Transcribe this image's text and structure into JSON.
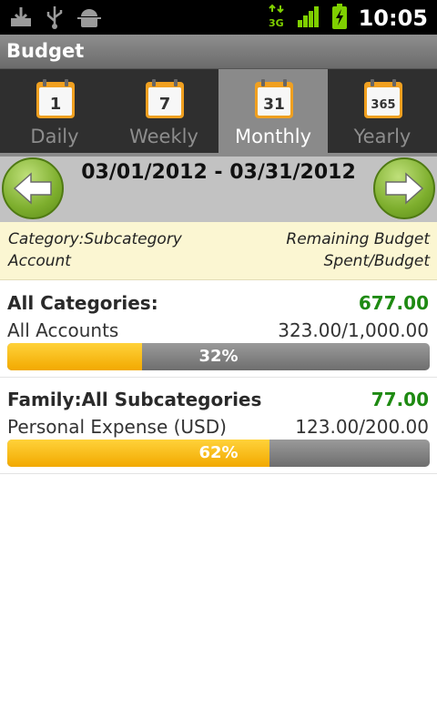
{
  "status_bar": {
    "time": "10:05",
    "network": "3G",
    "icons": [
      "download-icon",
      "usb-icon",
      "android-debug-icon",
      "network-3g-icon",
      "signal-icon",
      "battery-charging-icon"
    ]
  },
  "app": {
    "title": "Budget"
  },
  "tabs": [
    {
      "label": "Daily",
      "day": "1",
      "active": false
    },
    {
      "label": "Weekly",
      "day": "7",
      "active": false
    },
    {
      "label": "Monthly",
      "day": "31",
      "active": true
    },
    {
      "label": "Yearly",
      "day": "365",
      "active": false
    }
  ],
  "date_nav": {
    "range": "03/01/2012 - 03/31/2012"
  },
  "header": {
    "left_line1": "Category:Subcategory",
    "left_line2": "Account",
    "right_line1": "Remaining Budget",
    "right_line2": "Spent/Budget"
  },
  "items": [
    {
      "category": "All Categories:",
      "remaining": "677.00",
      "account": "All Accounts",
      "spent_budget": "323.00/1,000.00",
      "percent_label": "32%",
      "percent": 0.32
    },
    {
      "category": "Family:All Subcategories",
      "remaining": "77.00",
      "account": "Personal Expense (USD)",
      "spent_budget": "123.00/200.00",
      "percent_label": "62%",
      "percent": 0.62
    }
  ],
  "colors": {
    "remaining": "#1e8a12",
    "progress_fill": "#f6b800",
    "header_bg": "#fbf6d2",
    "active_tab": "#8a8a8a"
  }
}
